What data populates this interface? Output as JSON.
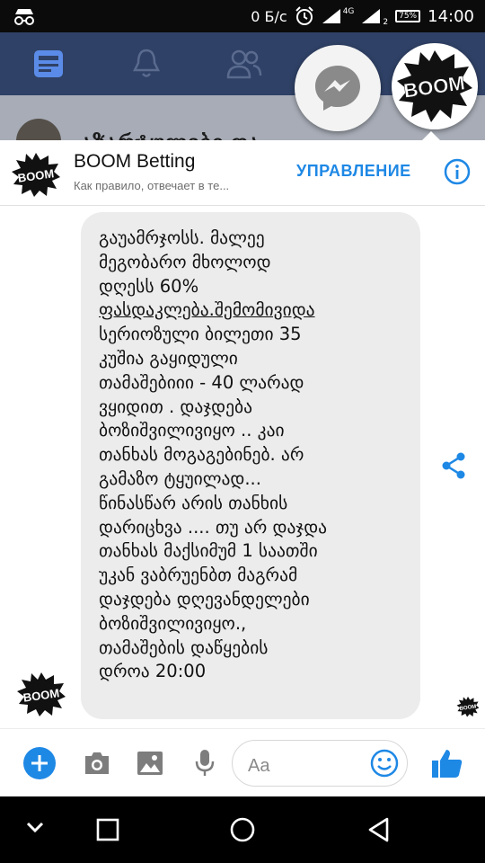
{
  "status_bar": {
    "data_rate": "0 Б/с",
    "network": "4G",
    "sim2": "2",
    "battery": "75%",
    "time": "14:00"
  },
  "background_post": {
    "title": "აზარტულები და"
  },
  "chat": {
    "name": "BOOM Betting",
    "subtitle": "Как правило, отвечает в те...",
    "manage_label": "УПРАВЛЕНИЕ",
    "message_lines": [
      "გაუამრჯოსს. მალეე",
      "მეგობარო მხოლოდ",
      "დღესს 60%",
      "ფასდაკლება.შემომივიდა",
      "სერიოზული ბილეთი 35",
      "კუშია გაყიდული",
      "თამაშებიიი - 40 ლარად",
      "ვყიდით . დაჯდება",
      "ბოზიშვილივიყო .. კაი",
      "თანხას მოგაგებინებ. არ",
      "გამაზო ტყუილად...",
      "წინასწარ არის თანხის",
      "დარიცხვა .... თუ არ დაჯდა",
      "თანხას მაქსიმუმ 1 საათში",
      "უკან ვაბრუენბთ მაგრამ",
      "დაჯდება დღევანდელები",
      "ბოზიშვილივიყო.,",
      "თამაშების დაწყების",
      "დროა 20:00"
    ]
  },
  "composer": {
    "placeholder": "Aa"
  },
  "logo_text": "BOOM",
  "colors": {
    "accent": "#1e88e5",
    "bubble": "#ececec",
    "status_bar": "#0b0b0b",
    "nav_bar": "#000000"
  },
  "icons": [
    "incognito-icon",
    "alarm-icon",
    "signal-icon",
    "battery-icon",
    "news-feed-icon",
    "bell-icon",
    "friends-icon",
    "messenger-icon",
    "info-icon",
    "share-icon",
    "plus-icon",
    "camera-icon",
    "gallery-icon",
    "mic-icon",
    "emoji-icon",
    "thumbs-up-icon",
    "back-icon",
    "home-icon",
    "recents-icon"
  ]
}
